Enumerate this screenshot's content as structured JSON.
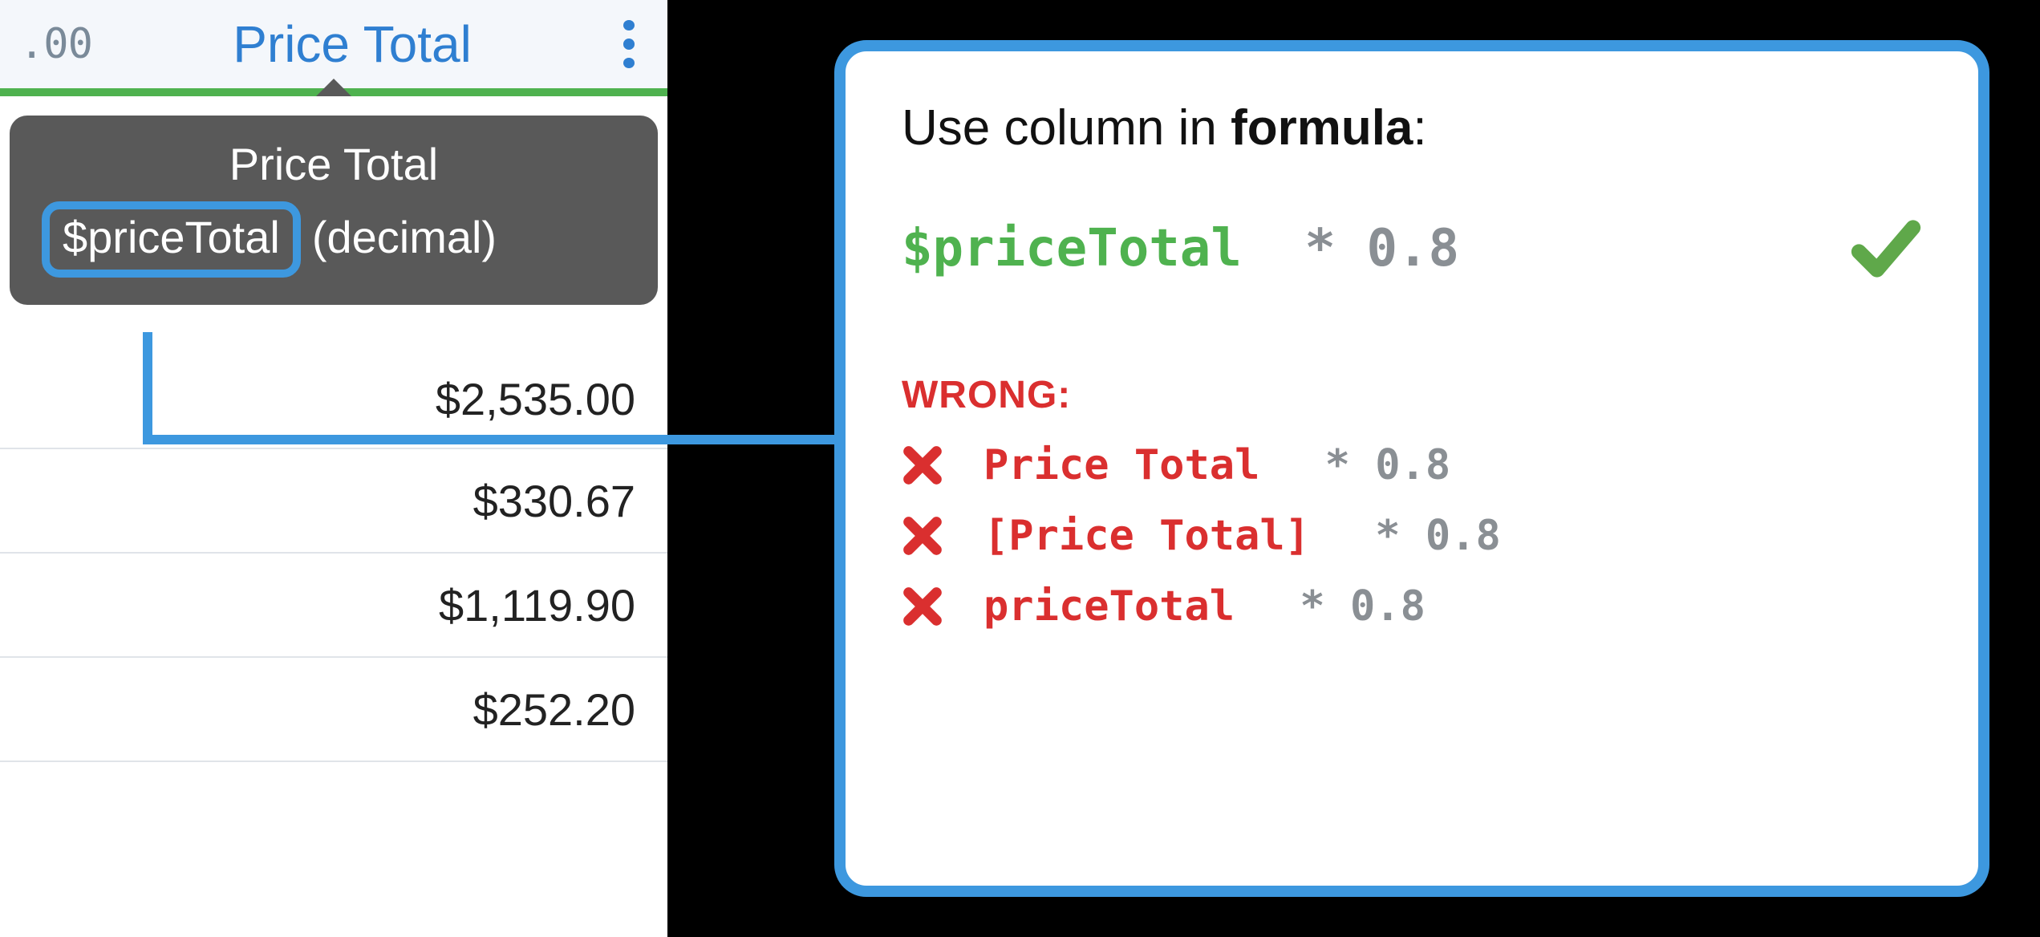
{
  "column": {
    "type_icon": ".00",
    "title": "Price Total",
    "tooltip": {
      "title": "Price Total",
      "identifier": "$priceTotal",
      "type_label": "(decimal)"
    },
    "cells": [
      "$2,535.00",
      "$330.67",
      "$1,119.90",
      "$252.20"
    ]
  },
  "callout": {
    "heading_pre": "Use column in ",
    "heading_bold": "formula",
    "heading_post": ":",
    "correct": {
      "id": "$priceTotal",
      "rest": " * 0.8"
    },
    "wrong_label": "WRONG:",
    "wrong": [
      {
        "bad": "Price Total",
        "rest": " * 0.8"
      },
      {
        "bad": "[Price Total]",
        "rest": " * 0.8"
      },
      {
        "bad": "priceTotal",
        "rest": " * 0.8"
      }
    ]
  }
}
